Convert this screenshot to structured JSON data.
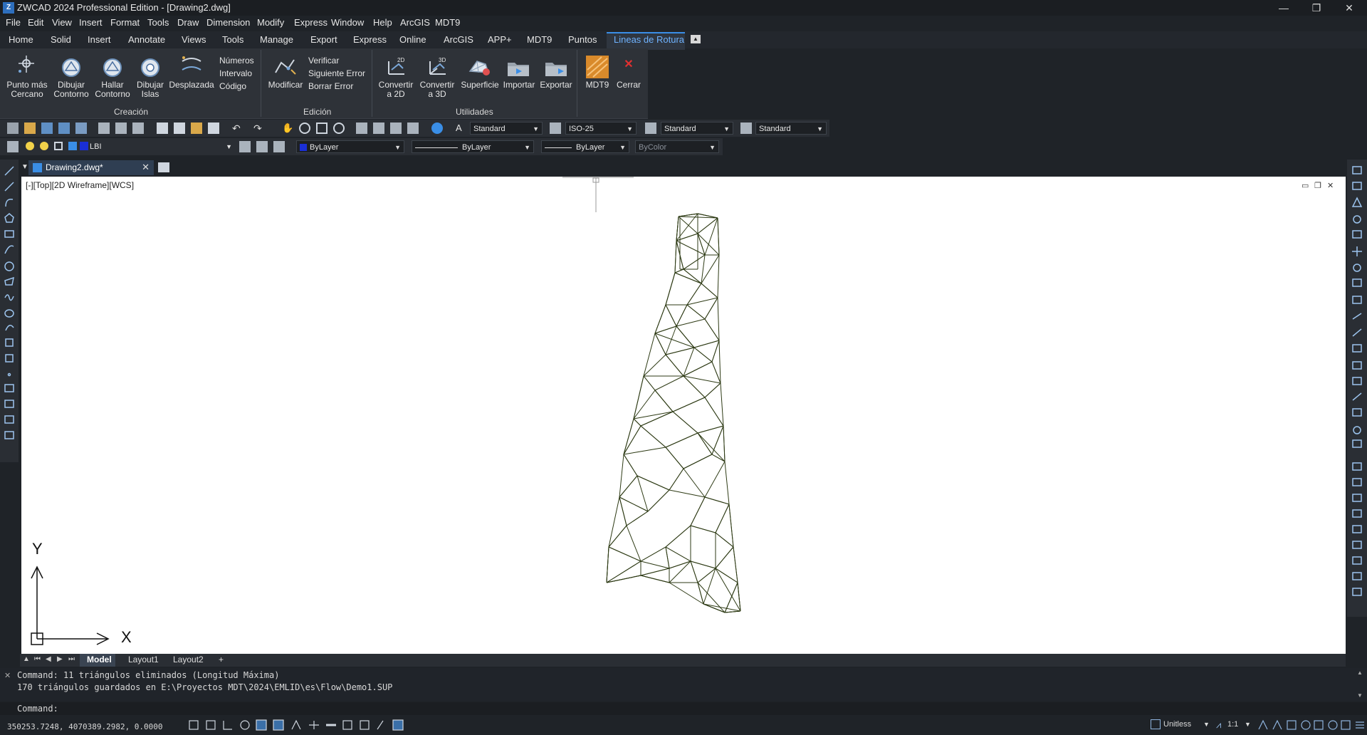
{
  "app": {
    "title": "ZWCAD 2024 Professional Edition - [Drawing2.dwg]",
    "logo_text": "Z"
  },
  "window_controls": {
    "minimize": "—",
    "restore": "❐",
    "close": "✕"
  },
  "menu": [
    "File",
    "Edit",
    "View",
    "Insert",
    "Format",
    "Tools",
    "Draw",
    "Dimension",
    "Modify",
    "Express",
    "Window",
    "Help",
    "ArcGIS",
    "MDT9"
  ],
  "ribbon_tabs": [
    "Home",
    "Solid",
    "Insert",
    "Annotate",
    "Views",
    "Tools",
    "Manage",
    "Export",
    "Express",
    "Online",
    "ArcGIS",
    "APP+",
    "MDT9",
    "Puntos",
    "Lineas de Rotura"
  ],
  "ribbon": {
    "creacion": {
      "title": "Creación",
      "buttons": [
        {
          "label1": "Punto más",
          "label2": "Cercano"
        },
        {
          "label1": "Dibujar",
          "label2": "Contorno"
        },
        {
          "label1": "Hallar",
          "label2": "Contorno"
        },
        {
          "label1": "Dibujar",
          "label2": "Islas"
        },
        {
          "label1": "Desplazada",
          "label2": ""
        }
      ],
      "list": [
        "Números",
        "Intervalo",
        "Código"
      ]
    },
    "edicion": {
      "title": "Edición",
      "button": "Modificar",
      "list": [
        "Verificar",
        "Siguiente Error",
        "Borrar Error"
      ]
    },
    "utilidades": {
      "title": "Utilidades",
      "buttons": [
        {
          "label1": "Convertir",
          "label2": "a 2D",
          "badge": "2D"
        },
        {
          "label1": "Convertir",
          "label2": "a 3D",
          "badge": "3D"
        },
        {
          "label1": "Superficie",
          "label2": ""
        },
        {
          "label1": "Importar",
          "label2": ""
        },
        {
          "label1": "Exportar",
          "label2": ""
        }
      ]
    },
    "mdt9": {
      "label": "MDT9"
    },
    "cerrar": {
      "label": "Cerrar"
    }
  },
  "toolbar1": {
    "text_style": "Standard",
    "dim_style": "ISO-25",
    "table_style": "Standard",
    "mleader_style": "Standard"
  },
  "toolbar2": {
    "layer": "LBI",
    "color": "ByLayer",
    "linetype": "ByLayer",
    "lineweight": "ByLayer",
    "plotstyle": "ByColor"
  },
  "document": {
    "tab": "Drawing2.dwg*"
  },
  "viewport": {
    "label": "[-][Top][2D Wireframe][WCS]"
  },
  "ucs": {
    "x": "X",
    "y": "Y"
  },
  "layout_tabs": [
    "Model",
    "Layout1",
    "Layout2",
    "+"
  ],
  "command": {
    "history": [
      "Command: 11 triángulos eliminados (Longitud Máxima)",
      "170 triángulos guardados en E:\\Proyectos MDT\\2024\\EMLID\\es\\Flow\\Demo1.SUP"
    ],
    "prompt": "Command:"
  },
  "status": {
    "coordinates": "350253.7248, 4070389.2982, 0.0000",
    "units": "Unitless",
    "scale": "1:1"
  },
  "colors": {
    "accent": "#3a8ee6",
    "active_tab": "#6fb3ff",
    "mesh": "#2d3a14",
    "canvas": "#ffffff"
  }
}
